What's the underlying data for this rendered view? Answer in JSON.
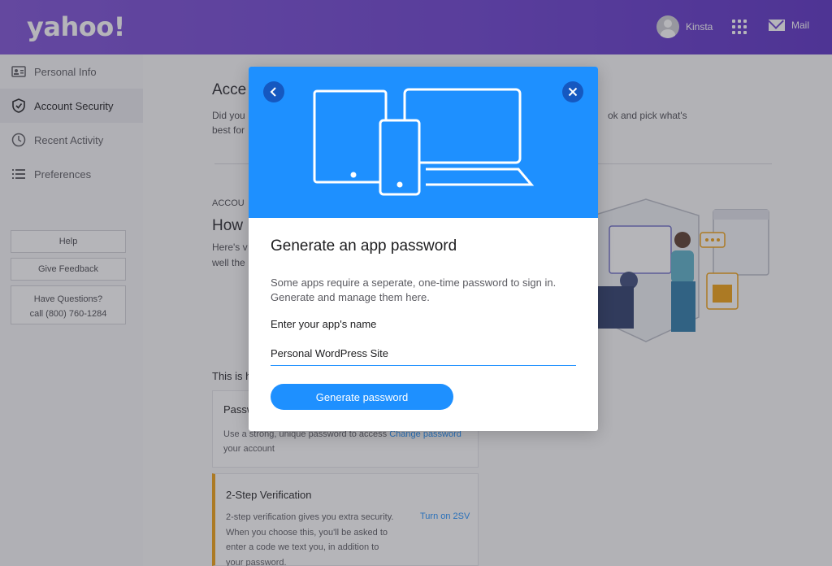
{
  "header": {
    "logo": "yahoo!",
    "username": "Kinsta",
    "mail_label": "Mail"
  },
  "sidebar": {
    "items": [
      {
        "label": "Personal Info",
        "icon": "id-card-icon"
      },
      {
        "label": "Account Security",
        "icon": "shield-icon"
      },
      {
        "label": "Recent Activity",
        "icon": "clock-icon"
      },
      {
        "label": "Preferences",
        "icon": "list-icon"
      }
    ],
    "help_label": "Help",
    "feedback_label": "Give Feedback",
    "questions_line1": "Have Questions?",
    "questions_line2": "call (800) 760-1284"
  },
  "main": {
    "title_fragment": "Acce",
    "intro_left_1": "Did you",
    "intro_left_2": "best for",
    "intro_right": "ok and pick what's",
    "section_label": "ACCOU",
    "section_heading": "How",
    "section_text_1": "Here's v",
    "section_text_2": "well the",
    "this_is": "This is h",
    "password_card": {
      "title": "Passw",
      "text_1": "Use a strong, unique password to access",
      "link": "Change password",
      "text_2": "your account"
    },
    "twostep_card": {
      "title": "2-Step Verification",
      "link": "Turn on 2SV",
      "lines": [
        "2-step verification gives you extra security.",
        "When you choose this, you'll be asked to",
        "enter a code we text you, in addition to",
        "your password."
      ]
    }
  },
  "modal": {
    "title": "Generate an app password",
    "description": "Some apps require a seperate, one-time password to sign in. Generate and manage them here.",
    "field_label": "Enter your app's name",
    "input_value": "Personal WordPress Site",
    "button_label": "Generate password"
  },
  "colors": {
    "header": "#6a3ed0",
    "accent": "#1e90ff",
    "button_dark": "#1558c0",
    "warning": "#f0a010"
  }
}
